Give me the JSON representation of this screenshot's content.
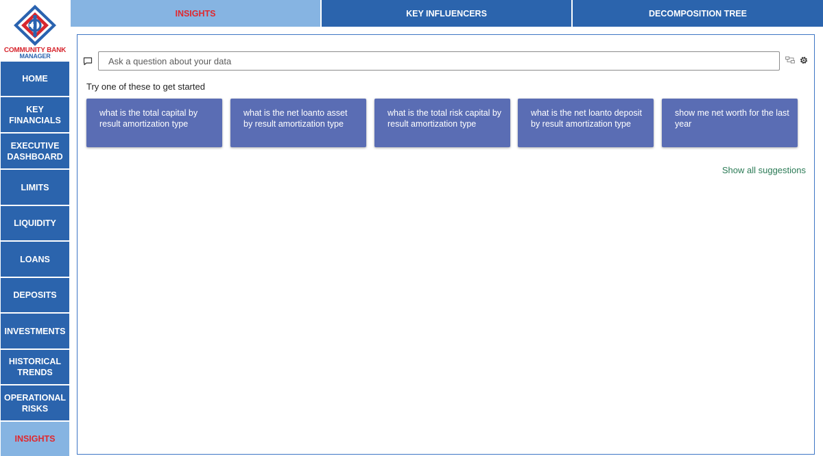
{
  "logo": {
    "line1": "COMMUNITY BANK",
    "line2": "MANAGER"
  },
  "sidebar": {
    "items": [
      {
        "label": "HOME",
        "active": false
      },
      {
        "label": "KEY FINANCIALS",
        "active": false
      },
      {
        "label": "EXECUTIVE DASHBOARD",
        "active": false
      },
      {
        "label": "LIMITS",
        "active": false
      },
      {
        "label": "LIQUIDITY",
        "active": false
      },
      {
        "label": "LOANS",
        "active": false
      },
      {
        "label": "DEPOSITS",
        "active": false
      },
      {
        "label": "INVESTMENTS",
        "active": false
      },
      {
        "label": "HISTORICAL TRENDS",
        "active": false
      },
      {
        "label": "OPERATIONAL RISKS",
        "active": false
      },
      {
        "label": "INSIGHTS",
        "active": true
      }
    ]
  },
  "tabs": [
    {
      "label": "INSIGHTS",
      "active": true
    },
    {
      "label": "KEY INFLUENCERS",
      "active": false
    },
    {
      "label": "DECOMPOSITION TREE",
      "active": false
    }
  ],
  "qa": {
    "placeholder": "Ask a question about your data",
    "prompt": "Try one of these to get started",
    "suggestions": [
      "what is the total capital by result amortization type",
      "what is the net loanto asset by result amortization type",
      "what is the total risk capital by result amortization type",
      "what is the net loanto deposit by result amortization type",
      "show me net worth for the last year"
    ],
    "show_all": "Show all suggestions"
  },
  "colors": {
    "nav_bg": "#2b64ad",
    "nav_active_bg": "#86b4e2",
    "active_text": "#e0282e",
    "suggestion_bg": "#5a6db4",
    "link": "#2a7a55"
  },
  "icons": [
    "logo-diamond-icon",
    "chat-icon",
    "tree-icon",
    "gear-icon"
  ]
}
